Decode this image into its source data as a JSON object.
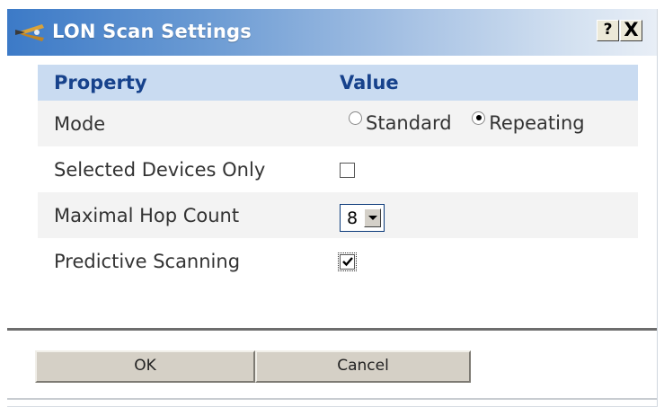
{
  "dialog": {
    "title": "LON Scan Settings",
    "help_label": "?",
    "close_label": "X",
    "icon": "scan-wand-icon"
  },
  "table": {
    "headers": [
      "Property",
      "Value"
    ],
    "rows": [
      {
        "property": "Mode",
        "options": [
          "Standard",
          "Repeating"
        ],
        "selected": "Repeating"
      },
      {
        "property": "Selected Devices Only",
        "checked": false
      },
      {
        "property": "Maximal Hop Count",
        "value": "8"
      },
      {
        "property": "Predictive Scanning",
        "checked": true
      }
    ]
  },
  "buttons": {
    "ok": "OK",
    "cancel": "Cancel"
  },
  "colors": {
    "title_bar_start": "#3c7ac7",
    "header_row": "#c9dbf1",
    "header_text": "#17428c",
    "alt_row": "#f3f3f3",
    "button_face": "#d5d0c6"
  }
}
